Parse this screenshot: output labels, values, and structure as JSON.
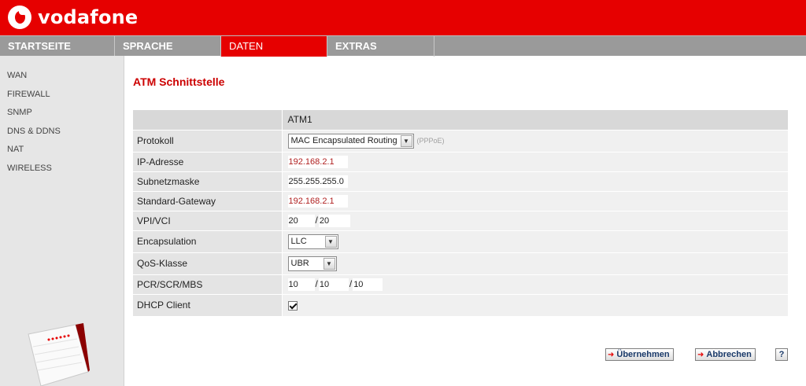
{
  "brand": {
    "name": "vodafone",
    "color": "#e60000"
  },
  "nav": {
    "tabs": [
      {
        "label": "STARTSEITE"
      },
      {
        "label": "SPRACHE"
      },
      {
        "label": "DATEN",
        "active": true
      },
      {
        "label": "EXTRAS"
      }
    ]
  },
  "sidebar": {
    "items": [
      {
        "label": "WAN"
      },
      {
        "label": "FIREWALL"
      },
      {
        "label": "SNMP"
      },
      {
        "label": "DNS & DDNS"
      },
      {
        "label": "NAT"
      },
      {
        "label": "WIRELESS"
      }
    ]
  },
  "page": {
    "title": "ATM Schnittstelle"
  },
  "table": {
    "column_header": "ATM1",
    "rows": {
      "protokoll": {
        "label": "Protokoll",
        "value": "MAC Encapsulated Routing",
        "hint": "(PPPoE)"
      },
      "ip": {
        "label": "IP-Adresse",
        "value": "192.168.2.1"
      },
      "subnet": {
        "label": "Subnetzmaske",
        "value": "255.255.255.0"
      },
      "gateway": {
        "label": "Standard-Gateway",
        "value": "192.168.2.1"
      },
      "vpivci": {
        "label": "VPI/VCI",
        "vpi": "20",
        "vci": "20",
        "sep": "/"
      },
      "encapsulation": {
        "label": "Encapsulation",
        "value": "LLC"
      },
      "qos": {
        "label": "QoS-Klasse",
        "value": "UBR"
      },
      "pcr": {
        "label": "PCR/SCR/MBS",
        "pcr": "10",
        "scr": "10",
        "mbs": "10",
        "sep": "/"
      },
      "dhcp": {
        "label": "DHCP Client",
        "checked": true
      }
    }
  },
  "buttons": {
    "apply": "Übernehmen",
    "cancel": "Abbrechen",
    "help": "?"
  }
}
